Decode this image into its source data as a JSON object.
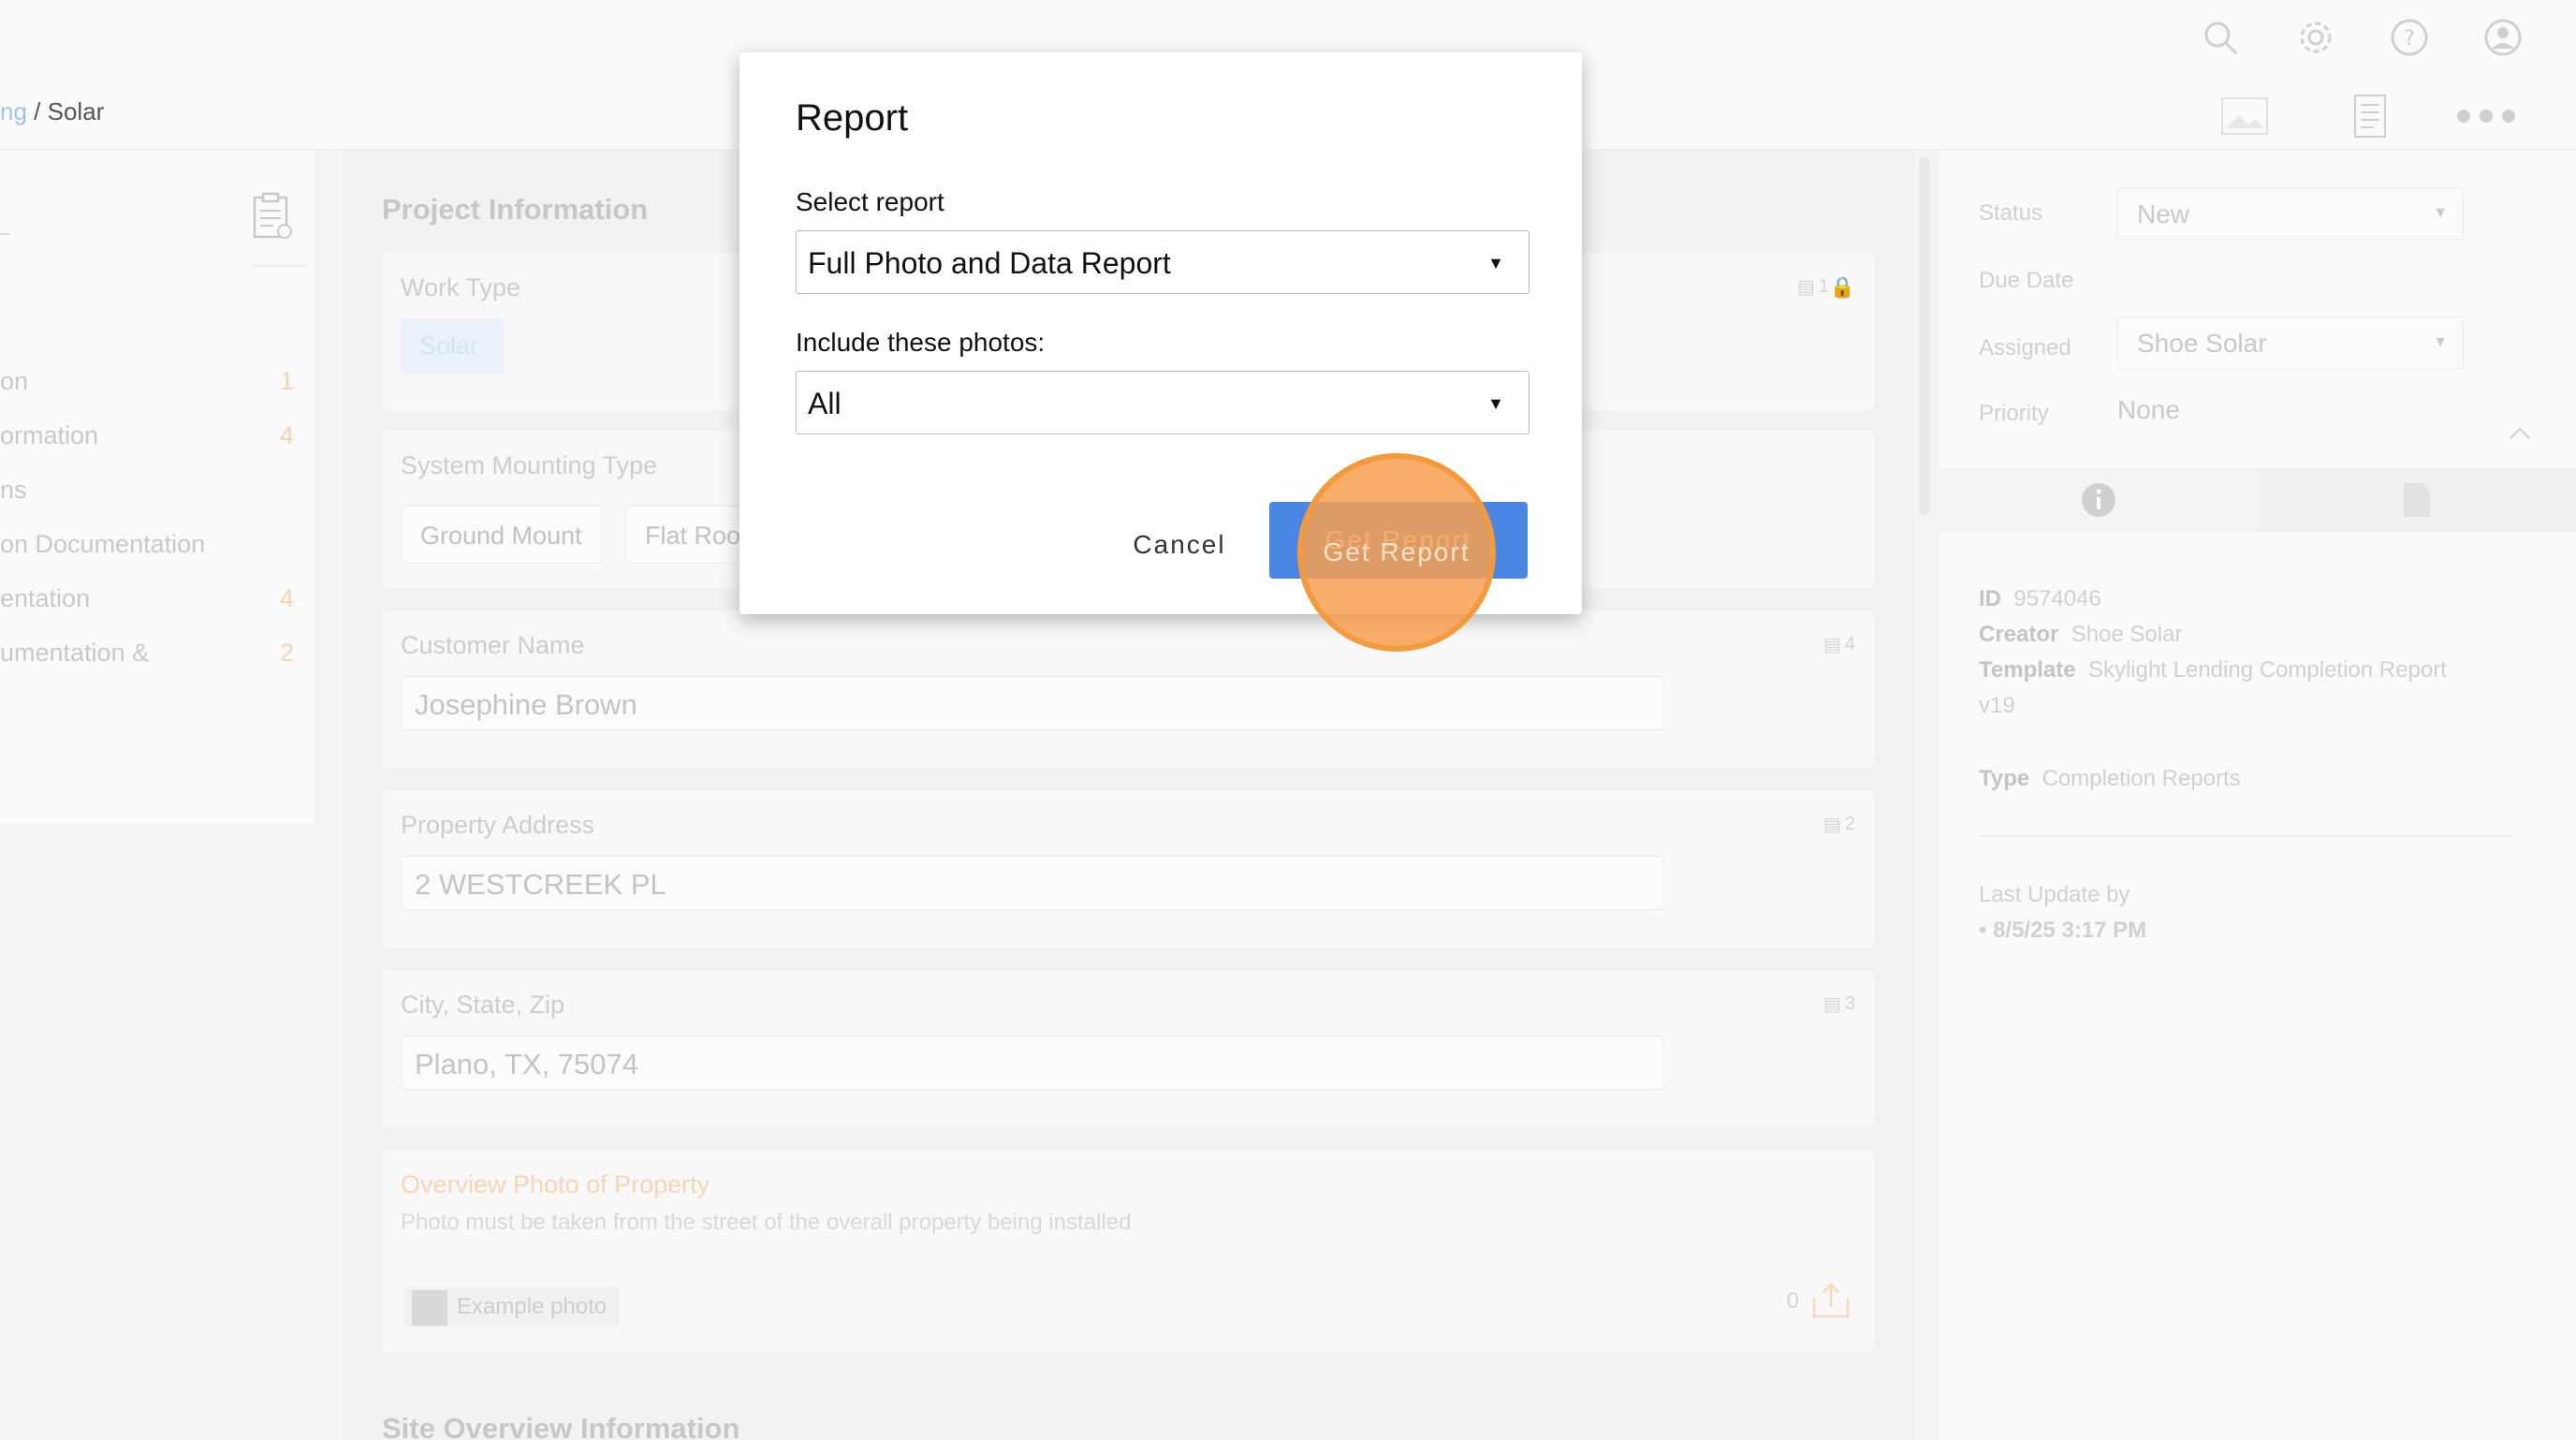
{
  "breadcrumb": {
    "prev": "ng",
    "sep": "/",
    "current": "Solar"
  },
  "sidebar": {
    "items": [
      {
        "label": "on",
        "count": "1"
      },
      {
        "label": "ormation",
        "count": "4"
      },
      {
        "label": "ns",
        "count": ""
      },
      {
        "label": "on Documentation",
        "count": ""
      },
      {
        "label": "entation",
        "count": "4"
      },
      {
        "label": "umentation &",
        "count": "2"
      }
    ]
  },
  "main": {
    "section_title": "Project Information",
    "section_title_2": "Site Overview Information",
    "work_type": {
      "label": "Work Type",
      "chip": "Solar",
      "photo_count": "1"
    },
    "mounting": {
      "label": "System Mounting Type",
      "chips": [
        "Ground Mount",
        "Flat Roo"
      ]
    },
    "customer": {
      "label": "Customer Name",
      "value": "Josephine Brown",
      "photo_count": "4"
    },
    "address": {
      "label": "Property Address",
      "value": "2 WESTCREEK PL",
      "photo_count": "2"
    },
    "city": {
      "label": "City, State, Zip",
      "value": "Plano, TX, 75074",
      "photo_count": "3"
    },
    "overview_photo": {
      "label": "Overview Photo of Property",
      "hint": "Photo must be taken from the street of the overall property being installed",
      "example": "Example photo",
      "count": "0"
    }
  },
  "right_panel": {
    "status_label": "Status",
    "status_value": "New",
    "due_label": "Due Date",
    "assigned_label": "Assigned",
    "assigned_value": "Shoe Solar",
    "priority_label": "Priority",
    "priority_value": "None",
    "id_label": "ID",
    "id_value": "9574046",
    "creator_label": "Creator",
    "creator_value": "Shoe Solar",
    "template_label": "Template",
    "template_value": "Skylight Lending Completion Report",
    "template_version": "v19",
    "type_label": "Type",
    "type_value": "Completion Reports",
    "last_update_label": "Last Update by",
    "last_update_value": "• 8/5/25 3:17 PM"
  },
  "dialog": {
    "title": "Report",
    "select_report_label": "Select report",
    "select_report_value": "Full Photo and Data Report",
    "include_label": "Include these photos:",
    "include_value": "All",
    "cancel_label": "Cancel",
    "get_report_label": "Get Report"
  },
  "colors": {
    "accent_blue": "#4a87e4",
    "highlight_orange": "#f29a3c",
    "count_orange": "#f6d3ad"
  },
  "caret_glyph": "▼"
}
